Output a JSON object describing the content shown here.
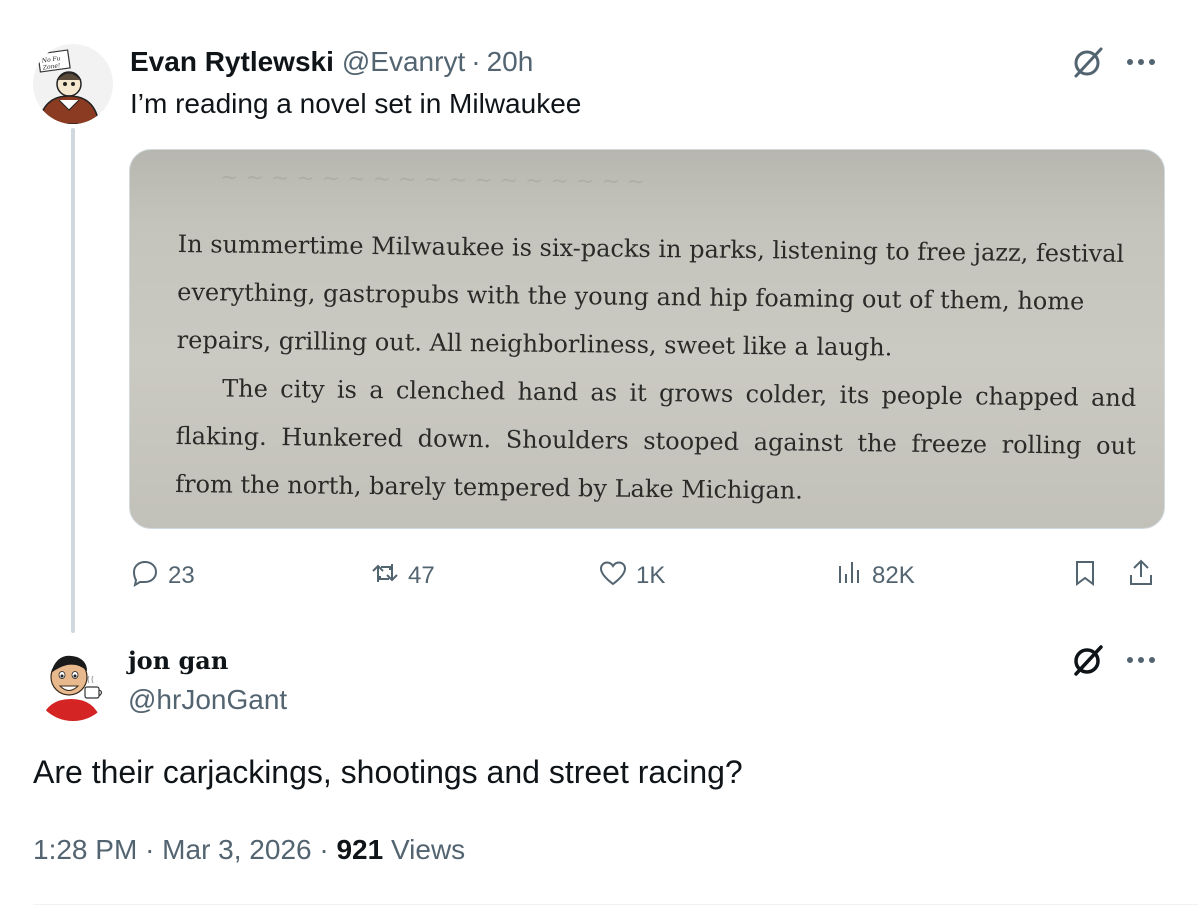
{
  "tweet": {
    "author": {
      "display_name": "Evan Rytlewski",
      "handle": "@Evanryt",
      "time": "20h",
      "avatar_sign_text": "No Fu Zone!"
    },
    "text": "I’m reading a novel set in Milwaukee",
    "media_excerpt": {
      "paragraph_1": "In summertime Milwaukee is six-packs in parks, listening to free jazz, festival everything, gastropubs with the young and hip foaming out of them, home repairs, grilling out. All neighborliness, sweet like a laugh.",
      "paragraph_2": "The city is a clenched hand as it grows colder, its people chapped and flaking. Hunkered down. Shoulders stooped against the freeze rolling out from the north, barely tempered by Lake Michigan."
    },
    "actions": {
      "replies": "23",
      "reposts": "47",
      "likes": "1K",
      "views": "82K"
    },
    "icons": {
      "grok": "grok-icon",
      "more": "more-icon",
      "reply": "reply-icon",
      "repost": "repost-icon",
      "like": "heart-icon",
      "views": "analytics-icon",
      "bookmark": "bookmark-icon",
      "share": "share-icon"
    }
  },
  "reply": {
    "author": {
      "display_name": "jon gan",
      "handle": "@hrJonGant"
    },
    "text": "Are their carjackings, shootings and street racing?",
    "meta": {
      "time": "1:28 PM",
      "date": "Mar 3, 2026",
      "views_count": "921",
      "views_label": "Views"
    }
  },
  "colors": {
    "text_primary": "#0f1419",
    "text_secondary": "#536471",
    "thread_line": "#cfd9de",
    "media_border": "#cfd9de"
  }
}
